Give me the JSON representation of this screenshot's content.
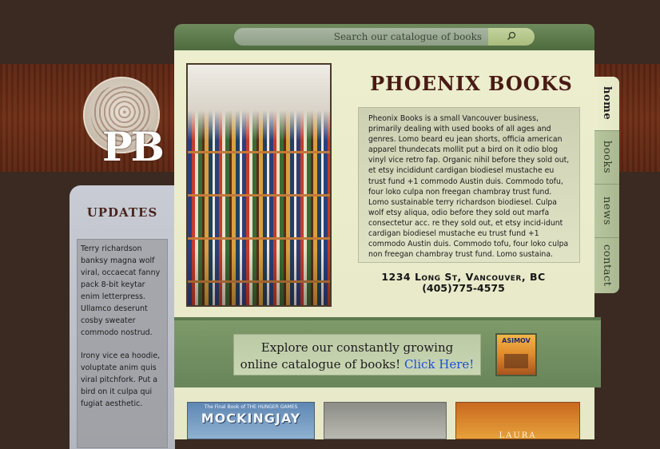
{
  "logo": {
    "initials": "PB"
  },
  "search": {
    "placeholder": "Search our catalogue of books",
    "button_icon": "magnifier-icon"
  },
  "main": {
    "title": "PHOENIX BOOKS",
    "description": "Pheonix Books is a small Vancouver business, primarily dealing with used books of all ages and genres. Lomo beard eu jean shorts, officia american apparel thundecats mollit put a bird on it odio blog vinyl vice retro fap. Organic nihil before they sold out, et etsy incididunt cardigan biodiesel mustache eu trust fund +1 commodo Austin duis. Commodo tofu, four loko culpa non freegan chambray trust fund. Lomo sustainable terry richardson biodiesel. Culpa wolf etsy aliqua, odio before they sold out marfa consectetur acc. re they sold out, et etsy incid-idunt cardigan biodiesel mustache eu trust fund +1 commodo Austin duis. Commodo tofu, four loko culpa non freegan  chambray trust fund. Lomo sustaina.",
    "address_line1": "1234 Long St, Vancouver, BC",
    "address_line2": "(405)775-4575"
  },
  "updates": {
    "heading": "UPDATES",
    "paragraphs": [
      "Terry richardson banksy magna wolf viral, occaecat fanny pack 8-bit keytar enim letterpress. Ullamco deserunt cosby sweater commodo nostrud.",
      "Irony vice ea hoodie, voluptate anim quis viral pitchfork. Put a bird on it culpa qui fugiat aesthetic."
    ]
  },
  "banner": {
    "text_line1": "Explore our constantly growing",
    "text_line2": "online catalogue of books!",
    "link_text": "Click Here!",
    "book_label": "ASIMOV"
  },
  "thumbs": [
    {
      "title": "MOCKINGJAY",
      "subtitle": "The Final Book of THE HUNGER GAMES"
    },
    {
      "title": ""
    },
    {
      "title": "LAURA"
    }
  ],
  "nav": [
    {
      "label": "home",
      "active": true
    },
    {
      "label": "books",
      "active": false
    },
    {
      "label": "news",
      "active": false
    },
    {
      "label": "contact",
      "active": false
    }
  ],
  "colors": {
    "background": "#3a2a21",
    "stripe": "#6e2d15",
    "panel": "#eceece",
    "green": "#68855a",
    "title": "#4a1a14",
    "link": "#1a4fe0"
  }
}
